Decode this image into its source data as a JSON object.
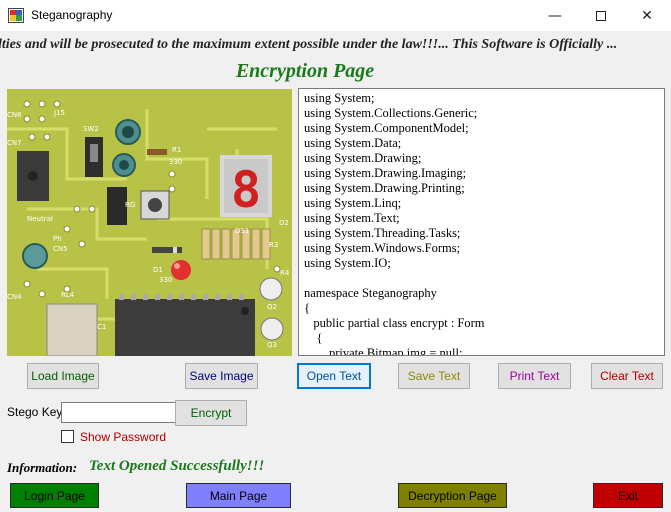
{
  "window": {
    "title": "Steganography"
  },
  "marquee": {
    "text": "lties and will be prosecuted to the maximum extent possible under the law!!!...  This Software is Officially ..."
  },
  "page_title": "Encryption Page",
  "code": [
    "using System;",
    "using System.Collections.Generic;",
    "using System.ComponentModel;",
    "using System.Data;",
    "using System.Drawing;",
    "using System.Drawing.Imaging;",
    "using System.Drawing.Printing;",
    "using System.Linq;",
    "using System.Text;",
    "using System.Threading.Tasks;",
    "using System.Windows.Forms;",
    "using System.IO;",
    "",
    "namespace Steganography",
    "{",
    "   public partial class encrypt : Form",
    "    {",
    "        private Bitmap img = null;"
  ],
  "buttons": {
    "load_image": "Load Image",
    "save_image": "Save Image",
    "open_text": "Open Text",
    "save_text": "Save Text",
    "print_text": "Print Text",
    "clear_text": "Clear Text",
    "encrypt": "Encrypt",
    "login_page": "Login Page",
    "main_page": "Main Page",
    "decryption_page": "Decryption Page",
    "exit": "Exit"
  },
  "stego": {
    "label": "Stego Key:",
    "value": "",
    "show_password": "Show Password",
    "show_password_checked": false
  },
  "info": {
    "label": "Information:",
    "value": "Text Opened Successfully!!!"
  },
  "image_board": {
    "labels": [
      "R1",
      "330",
      "SW2",
      "DS1",
      "C1",
      "Q2",
      "Q3",
      "D1",
      "330",
      "RL4",
      "CN4",
      "CN5",
      "CN6",
      "CN7",
      "J15",
      "Neutral",
      "Ph",
      "D2",
      "R4",
      "R3",
      "RG"
    ],
    "display_digit": "8"
  },
  "colors": {
    "title_green": "#1a7a1a",
    "login_btn": "#008000",
    "main_btn": "#8080ff",
    "decrypt_btn": "#808000",
    "exit_btn": "#c00000",
    "open_text_color": "#0050a0",
    "save_text_color": "#8b8b00",
    "print_text_color": "#a000a0",
    "clear_text_color": "#b00000",
    "load_image_color": "#006000",
    "save_image_color": "#000080",
    "encrypt_color": "#006000"
  },
  "icons": {
    "app": "steganography-app-icon",
    "minimize": "minimize-icon",
    "maximize": "maximize-icon",
    "close": "close-icon"
  }
}
